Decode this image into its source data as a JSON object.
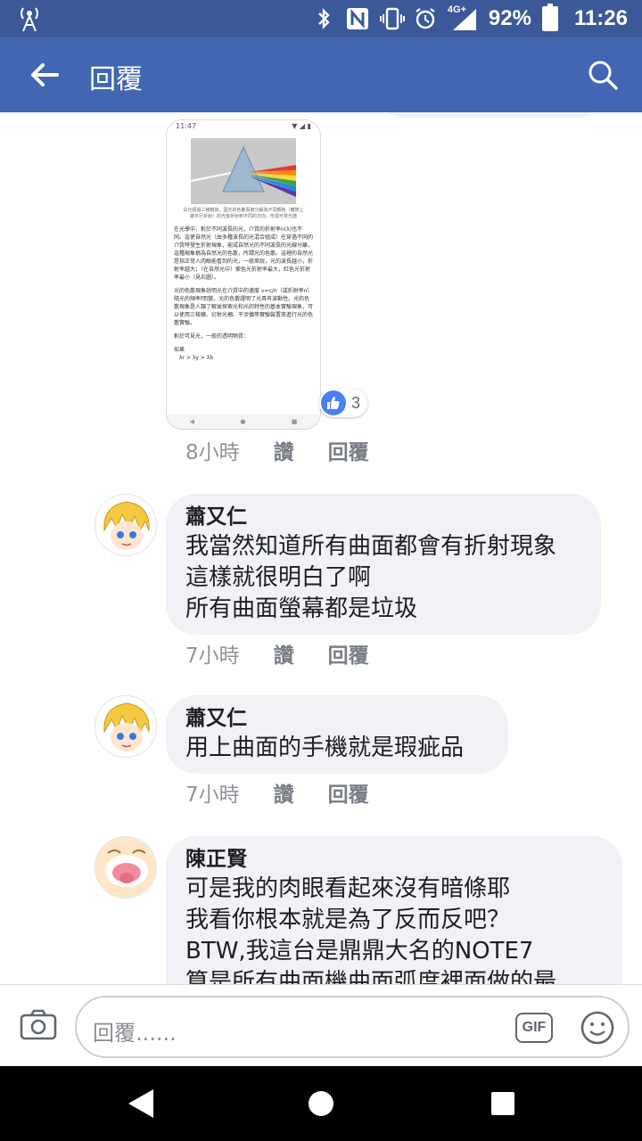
{
  "status_bar": {
    "network": "4G+",
    "battery": "92%",
    "time": "11:26",
    "icons": [
      "antenna-icon",
      "bluetooth-icon",
      "nfc-icon",
      "vibrate-icon",
      "alarm-icon",
      "signal-icon",
      "battery-icon"
    ]
  },
  "header": {
    "title": "回覆",
    "back_icon": "back-arrow-icon",
    "search_icon": "search-icon",
    "color": "#4267b2"
  },
  "attachment": {
    "status": "11:47",
    "caption": "白光經過三稜鏡後，因光的色散而被分解為不同顏色（實際上被平行折射）的光後折射到不同的方向，形成可見光譜",
    "paragraphs": [
      "在光學中，對於不同波長的光，介質的折射率n(λ)也不同。這使自然光（由多種波長的光混合組成）在穿過不同的介質時發生折射現象，能成自然光的不同波長的光線分離，這種現象稱為自然光的色散，所謂光的色散。這裡的自然光是指正常人肉眼能看到的光，一般來說，光的波長越小，折射率越大；（在自然光中）紫色光折射率最大，紅色光折射率最小（見右圖）。",
      "光的色散現象說明光在介質中的速度 v=c/n（或折射率n）隨光的頻率f而變。光的色散證明了光具有波動性。光的色散現象是人類了解並探索光和光的特性的基本實驗現象，可以使用三稜鏡、衍射光柵、干涉儀等實驗裝置來進行光的色散實驗。",
      "對於可見光，一般的透明物質：",
      "如果",
      "λr > λy > λb"
    ],
    "reaction_count": "3"
  },
  "comments": [
    {
      "name": "",
      "text": "",
      "time": "8小時",
      "like_label": "讚",
      "reply_label": "回覆"
    },
    {
      "name": "蕭又仁",
      "text": "我當然知道所有曲面都會有折射現象\n這樣就很明白了啊\n所有曲面螢幕都是垃圾",
      "time": "7小時",
      "like_label": "讚",
      "reply_label": "回覆"
    },
    {
      "name": "蕭又仁",
      "text": "用上曲面的手機就是瑕疵品",
      "time": "7小時",
      "like_label": "讚",
      "reply_label": "回覆"
    },
    {
      "name": "陳正賢",
      "text": "可是我的肉眼看起來沒有暗條耶\n我看你根本就是為了反而反吧？\nBTW,我這台是鼎鼎大名的NOTE7\n算是所有曲面機曲面弧度裡面做的最",
      "time": "",
      "like_label": "",
      "reply_label": ""
    }
  ],
  "composer": {
    "placeholder": "回覆......",
    "gif_label": "GIF",
    "camera_icon": "camera-icon",
    "emoji_icon": "smiley-icon"
  },
  "navbar": {
    "icons": [
      "back-triangle-icon",
      "home-circle-icon",
      "recents-square-icon"
    ]
  }
}
